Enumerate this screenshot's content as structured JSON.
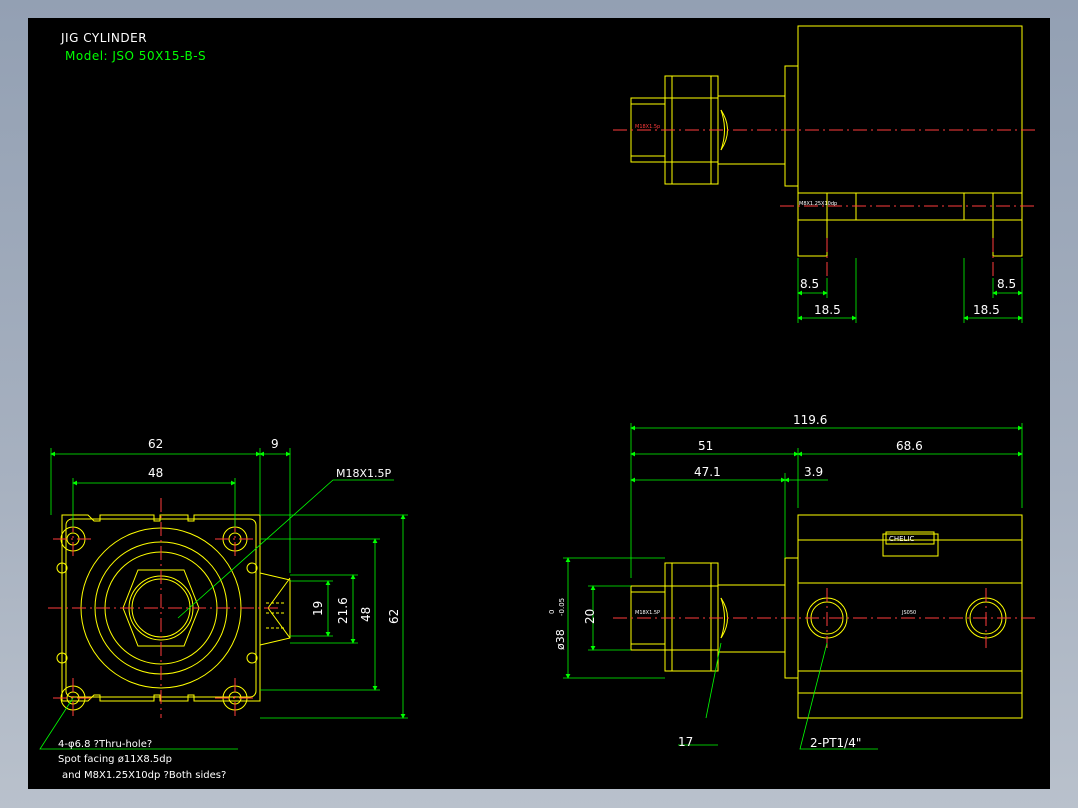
{
  "title_block": {
    "title": "JIG CYLINDER",
    "model": "Model: JSO 50X15-B-S"
  },
  "colors": {
    "background": "#000000",
    "outline": "#ffff00",
    "dimension": "#00ff00",
    "centerline": "#ff3b3b",
    "text": "#ffffff",
    "frame": "#93a0b3"
  },
  "top_view": {
    "dims": {
      "d1": "8.5",
      "d2": "18.5",
      "d3": "18.5",
      "d4": "8.5"
    },
    "labels": {
      "thread": "M18X1.5p",
      "mount_thread": "M8X1.25X10dp"
    }
  },
  "front_view": {
    "dims": {
      "width": "62",
      "right_offset": "9",
      "hole_span": "48",
      "height_19": "19",
      "height_21_6": "21.6",
      "height_48": "48",
      "height_62": "62"
    },
    "callout_thread": "M18X1.5P",
    "notes": {
      "line1": "4-φ6.8    ?Thru-hole?",
      "line2": "Spot facing  ø11X8.5dp",
      "line3": "and M8X1.25X10dp ?Both sides?"
    }
  },
  "side_view": {
    "dims": {
      "total": "119.6",
      "left": "51",
      "right": "68.6",
      "sub": "47.1",
      "small": "3.9",
      "dia20": "20",
      "dia38": "ø38",
      "dia38_tol_upper": "0",
      "dia38_tol_lower": "-0.05",
      "wrench": "17",
      "port": "2-PT1/4\""
    },
    "labels": {
      "brand": "CHELIC",
      "part": "JS050",
      "thread": "M18X1.5P"
    }
  }
}
